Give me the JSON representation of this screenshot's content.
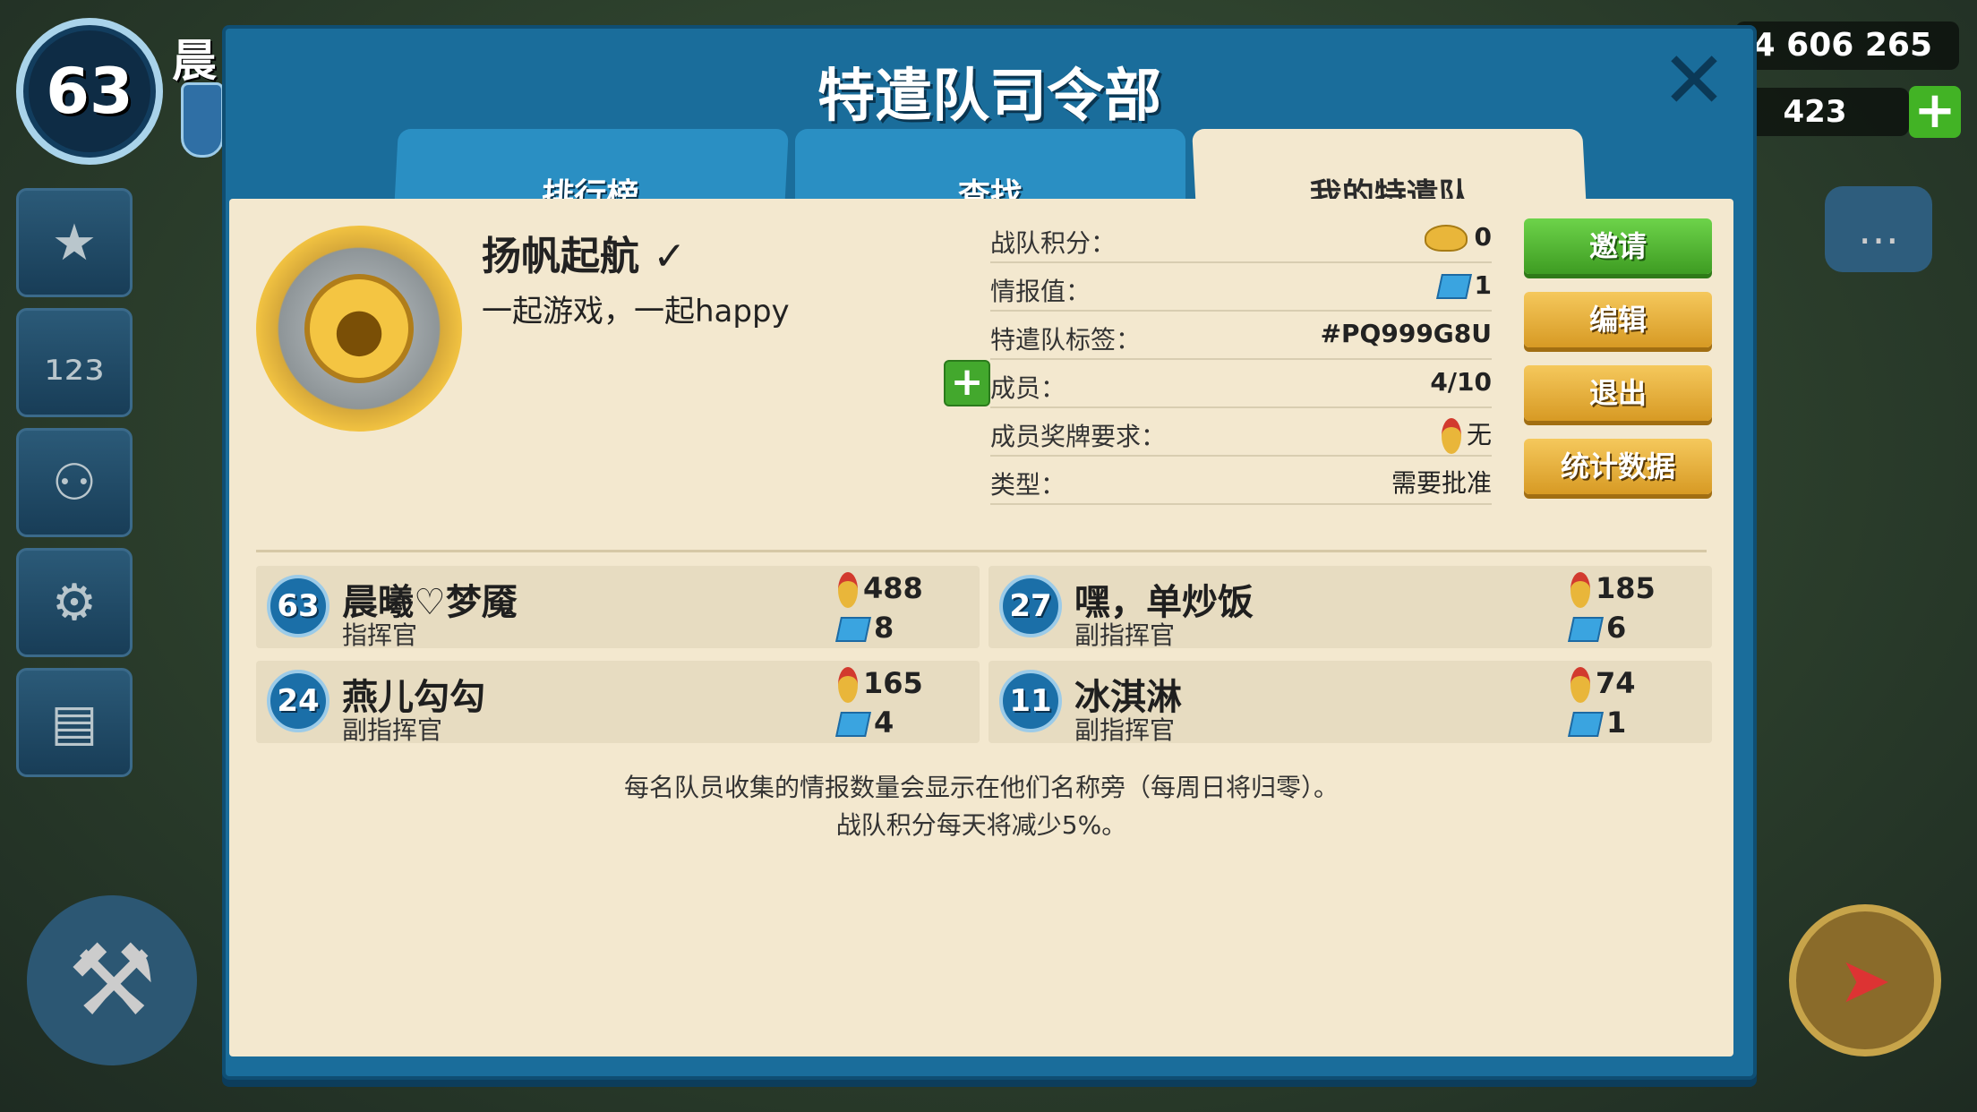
{
  "hud": {
    "player_level": "63",
    "player_name": "晨",
    "resource_amount": "4 606 265",
    "gems": "423",
    "plus_icon": "+"
  },
  "dialog": {
    "title": "特遣队司令部",
    "close_icon": "✕",
    "tabs": [
      {
        "label": "排行榜",
        "active": false
      },
      {
        "label": "查找",
        "active": false
      },
      {
        "label": "我的特遣队",
        "active": true
      }
    ]
  },
  "team": {
    "name": "扬帆起航",
    "check_icon": "✓",
    "description": "一起游戏，一起happy",
    "stats": [
      {
        "label": "战队积分：",
        "value": "0",
        "icon": "wing-icon"
      },
      {
        "label": "情报值：",
        "value": "1",
        "icon": "intel-icon"
      },
      {
        "label": "特遣队标签：",
        "value": "#PQ999G8U",
        "icon": ""
      },
      {
        "label": "成员：",
        "value": "4/10",
        "icon": ""
      },
      {
        "label": "成员奖牌要求：",
        "value": "无",
        "icon": "medal-icon"
      },
      {
        "label": "类型：",
        "value": "需要批准",
        "icon": ""
      }
    ],
    "add_member_icon": "+"
  },
  "actions": {
    "invite": "邀请",
    "edit": "编辑",
    "leave": "退出",
    "stats": "统计数据"
  },
  "members": [
    {
      "level": "63",
      "name": "晨曦♡梦魇",
      "role": "指挥官",
      "medals": "488",
      "intel": "8"
    },
    {
      "level": "27",
      "name": "嘿，单炒饭",
      "role": "副指挥官",
      "medals": "185",
      "intel": "6"
    },
    {
      "level": "24",
      "name": "燕儿勾勾",
      "role": "副指挥官",
      "medals": "165",
      "intel": "4"
    },
    {
      "level": "11",
      "name": "冰淇淋",
      "role": "副指挥官",
      "medals": "74",
      "intel": "1"
    }
  ],
  "footer": {
    "line1": "每名队员收集的情报数量会显示在他们名称旁（每周日将归零）。",
    "line2": "战队积分每天将减少5%。"
  },
  "colors": {
    "dialog_blue": "#1a6d9b",
    "panel_cream": "#f3e8cf",
    "invite_green": "#4fb52d",
    "action_gold": "#e3ad3c"
  }
}
